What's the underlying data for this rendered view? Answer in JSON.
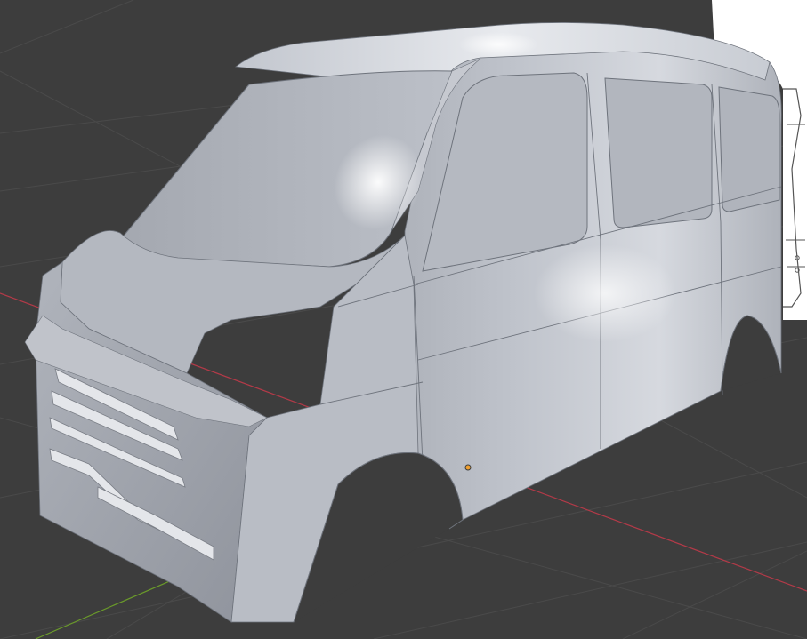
{
  "viewport": {
    "background_color": "#3d3d3d",
    "grid_color": "#4a4a4a",
    "x_axis_color": "#b23a48",
    "y_axis_color": "#6a9a2a"
  },
  "model": {
    "body_color": "#b8bcc4",
    "highlight_color": "#f4f5f8",
    "shadow_color": "#868a93",
    "edge_color": "#6e737c"
  },
  "reference_image": {
    "background_color": "#ffffff",
    "line_color": "#555555"
  },
  "object_origin": {
    "color": "#f0a030"
  }
}
